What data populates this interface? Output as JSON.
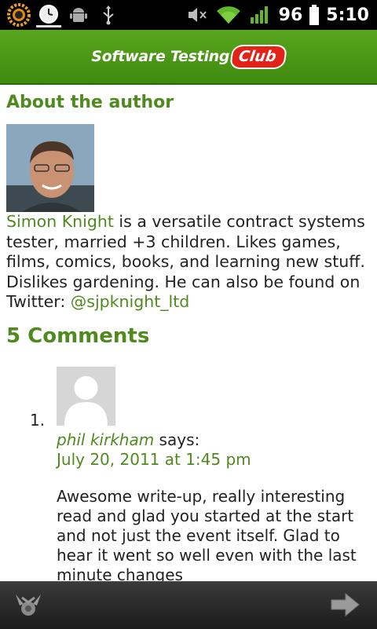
{
  "status_bar": {
    "battery": "96",
    "time": "5:10",
    "icons": [
      "sun-app-icon",
      "clock-icon",
      "android-icon",
      "usb-icon",
      "mute-icon",
      "wifi-icon",
      "signal-icon",
      "battery-icon"
    ]
  },
  "header": {
    "logo_text_main": "Software Testing",
    "logo_text_pill": "Club"
  },
  "about": {
    "heading": "About the author",
    "author_link": "Simon Knight",
    "bio_text": " is a versatile contract systems tester, married +3 children. Likes games, films, comics, books, and learning new stuff. Dislikes gardening. He can also be found on Twitter: ",
    "twitter_link": "@sjpknight_ltd"
  },
  "comments": {
    "heading": "5 Comments",
    "items": [
      {
        "number": "1.",
        "author": "phil kirkham",
        "says": " says:",
        "date": "July 20, 2011 at 1:45 pm",
        "body": "Awesome write-up, really interesting read and glad you started at the start and not just the event itself. Glad to hear it went so well even with the last minute changes"
      }
    ]
  },
  "colors": {
    "accent_green": "#4f8a1f",
    "header_green": "#4d9a18",
    "pill_red": "#e2231a"
  }
}
